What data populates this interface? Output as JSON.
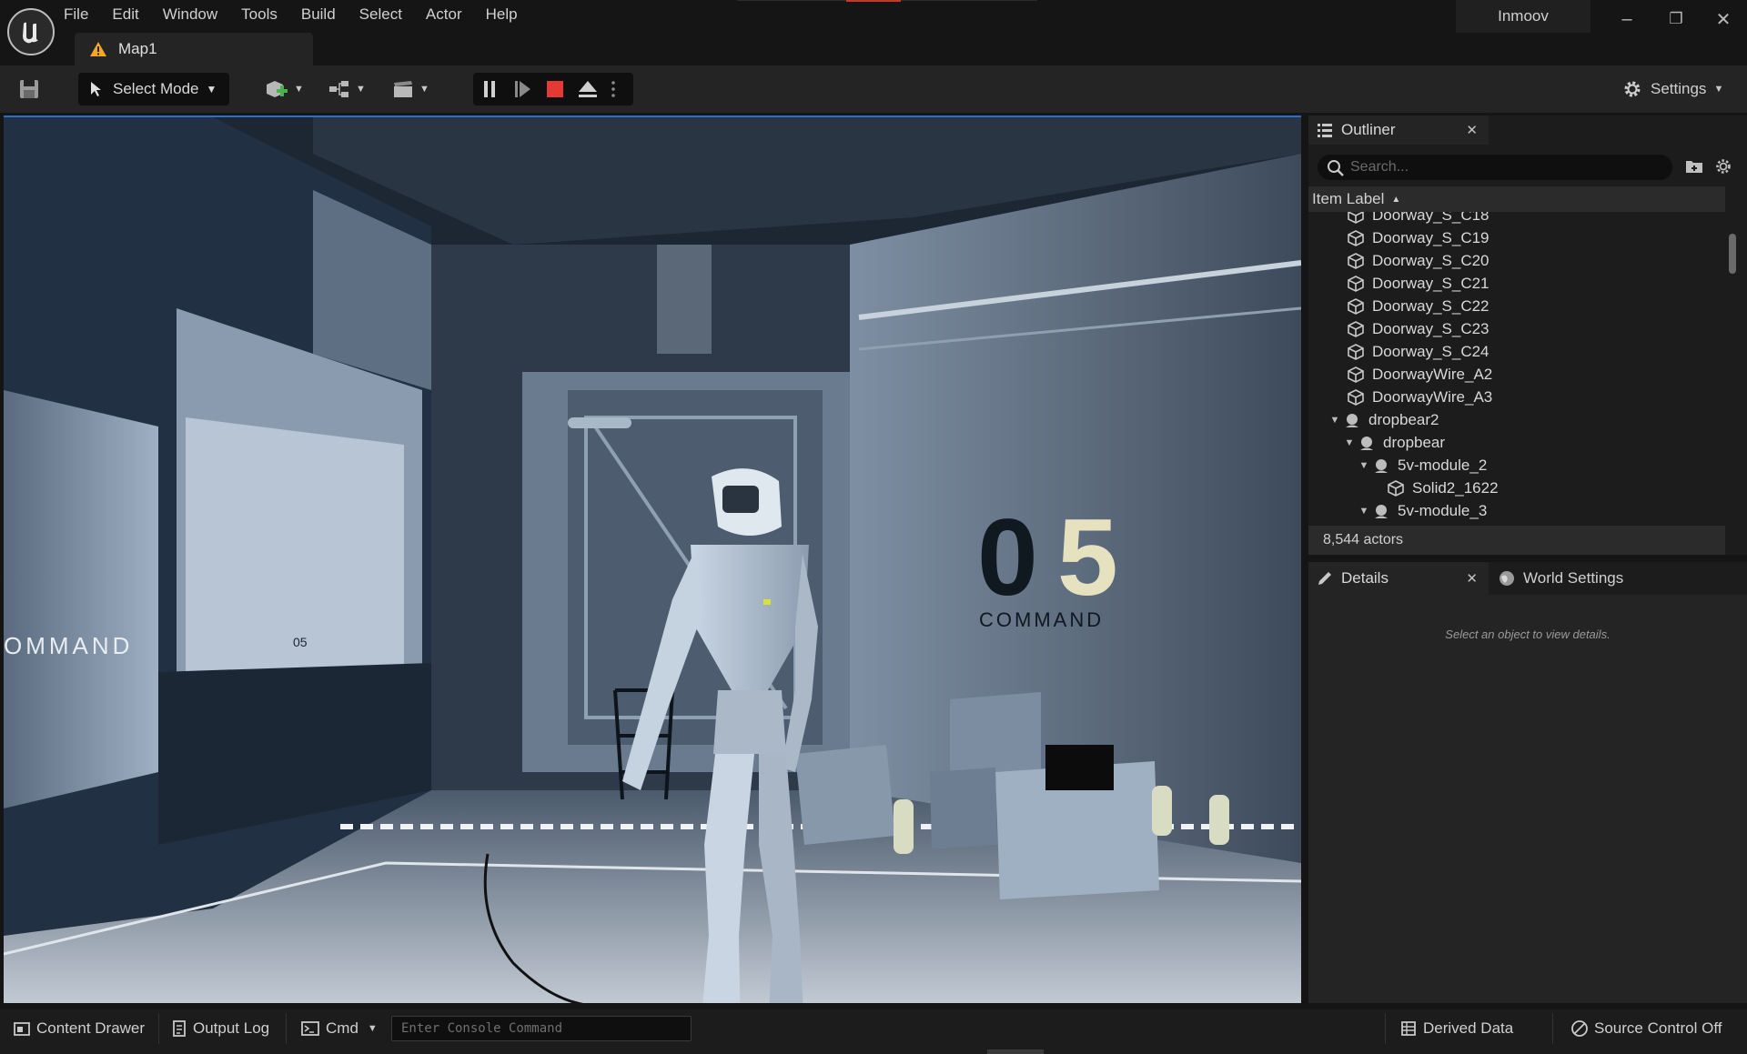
{
  "menu": {
    "items": [
      "File",
      "Edit",
      "Window",
      "Tools",
      "Build",
      "Select",
      "Actor",
      "Help"
    ]
  },
  "window": {
    "map_tab": "Map1",
    "project_name": "Inmoov",
    "minimize": "–",
    "restore": "❐",
    "close": "✕"
  },
  "toolbar": {
    "select_mode": "Select Mode",
    "settings": "Settings"
  },
  "viewport": {
    "sign_text_big": "05",
    "sign_text_small": "COMMAND",
    "left_wall_text": "OMMAND",
    "locker_label": "05"
  },
  "outliner": {
    "tab_label": "Outliner",
    "search_placeholder": "Search...",
    "column_label": "Item Label",
    "items": [
      {
        "label": "Doorway_S_C18",
        "depth": 1,
        "icon": "static-mesh-icon",
        "expand": ""
      },
      {
        "label": "Doorway_S_C19",
        "depth": 1,
        "icon": "static-mesh-icon",
        "expand": ""
      },
      {
        "label": "Doorway_S_C20",
        "depth": 1,
        "icon": "static-mesh-icon",
        "expand": ""
      },
      {
        "label": "Doorway_S_C21",
        "depth": 1,
        "icon": "static-mesh-icon",
        "expand": ""
      },
      {
        "label": "Doorway_S_C22",
        "depth": 1,
        "icon": "static-mesh-icon",
        "expand": ""
      },
      {
        "label": "Doorway_S_C23",
        "depth": 1,
        "icon": "static-mesh-icon",
        "expand": ""
      },
      {
        "label": "Doorway_S_C24",
        "depth": 1,
        "icon": "static-mesh-icon",
        "expand": ""
      },
      {
        "label": "DoorwayWire_A2",
        "depth": 1,
        "icon": "static-mesh-icon",
        "expand": ""
      },
      {
        "label": "DoorwayWire_A3",
        "depth": 1,
        "icon": "static-mesh-icon",
        "expand": ""
      },
      {
        "label": "dropbear2",
        "depth": 0,
        "icon": "actor-sphere-icon",
        "expand": "▼"
      },
      {
        "label": "dropbear",
        "depth": 1,
        "icon": "actor-sphere-icon",
        "expand": "▼"
      },
      {
        "label": "5v-module_2",
        "depth": 2,
        "icon": "actor-sphere-icon",
        "expand": "▼"
      },
      {
        "label": "Solid2_1622",
        "depth": 3,
        "icon": "static-mesh-icon",
        "expand": ""
      },
      {
        "label": "5v-module_3",
        "depth": 2,
        "icon": "actor-sphere-icon",
        "expand": "▼"
      }
    ],
    "actor_count": "8,544 actors"
  },
  "details": {
    "tab_label": "Details",
    "world_settings_label": "World Settings",
    "empty_message": "Select an object to view details."
  },
  "statusbar": {
    "content_drawer": "Content Drawer",
    "output_log": "Output Log",
    "cmd": "Cmd",
    "console_placeholder": "Enter Console Command",
    "derived_data": "Derived Data",
    "source_control": "Source Control Off"
  },
  "colors": {
    "accent_blue": "#2b6ec4",
    "stop_red": "#e53935",
    "warning_orange": "#f5a623",
    "panel_bg": "#242424",
    "app_bg": "#151515"
  }
}
